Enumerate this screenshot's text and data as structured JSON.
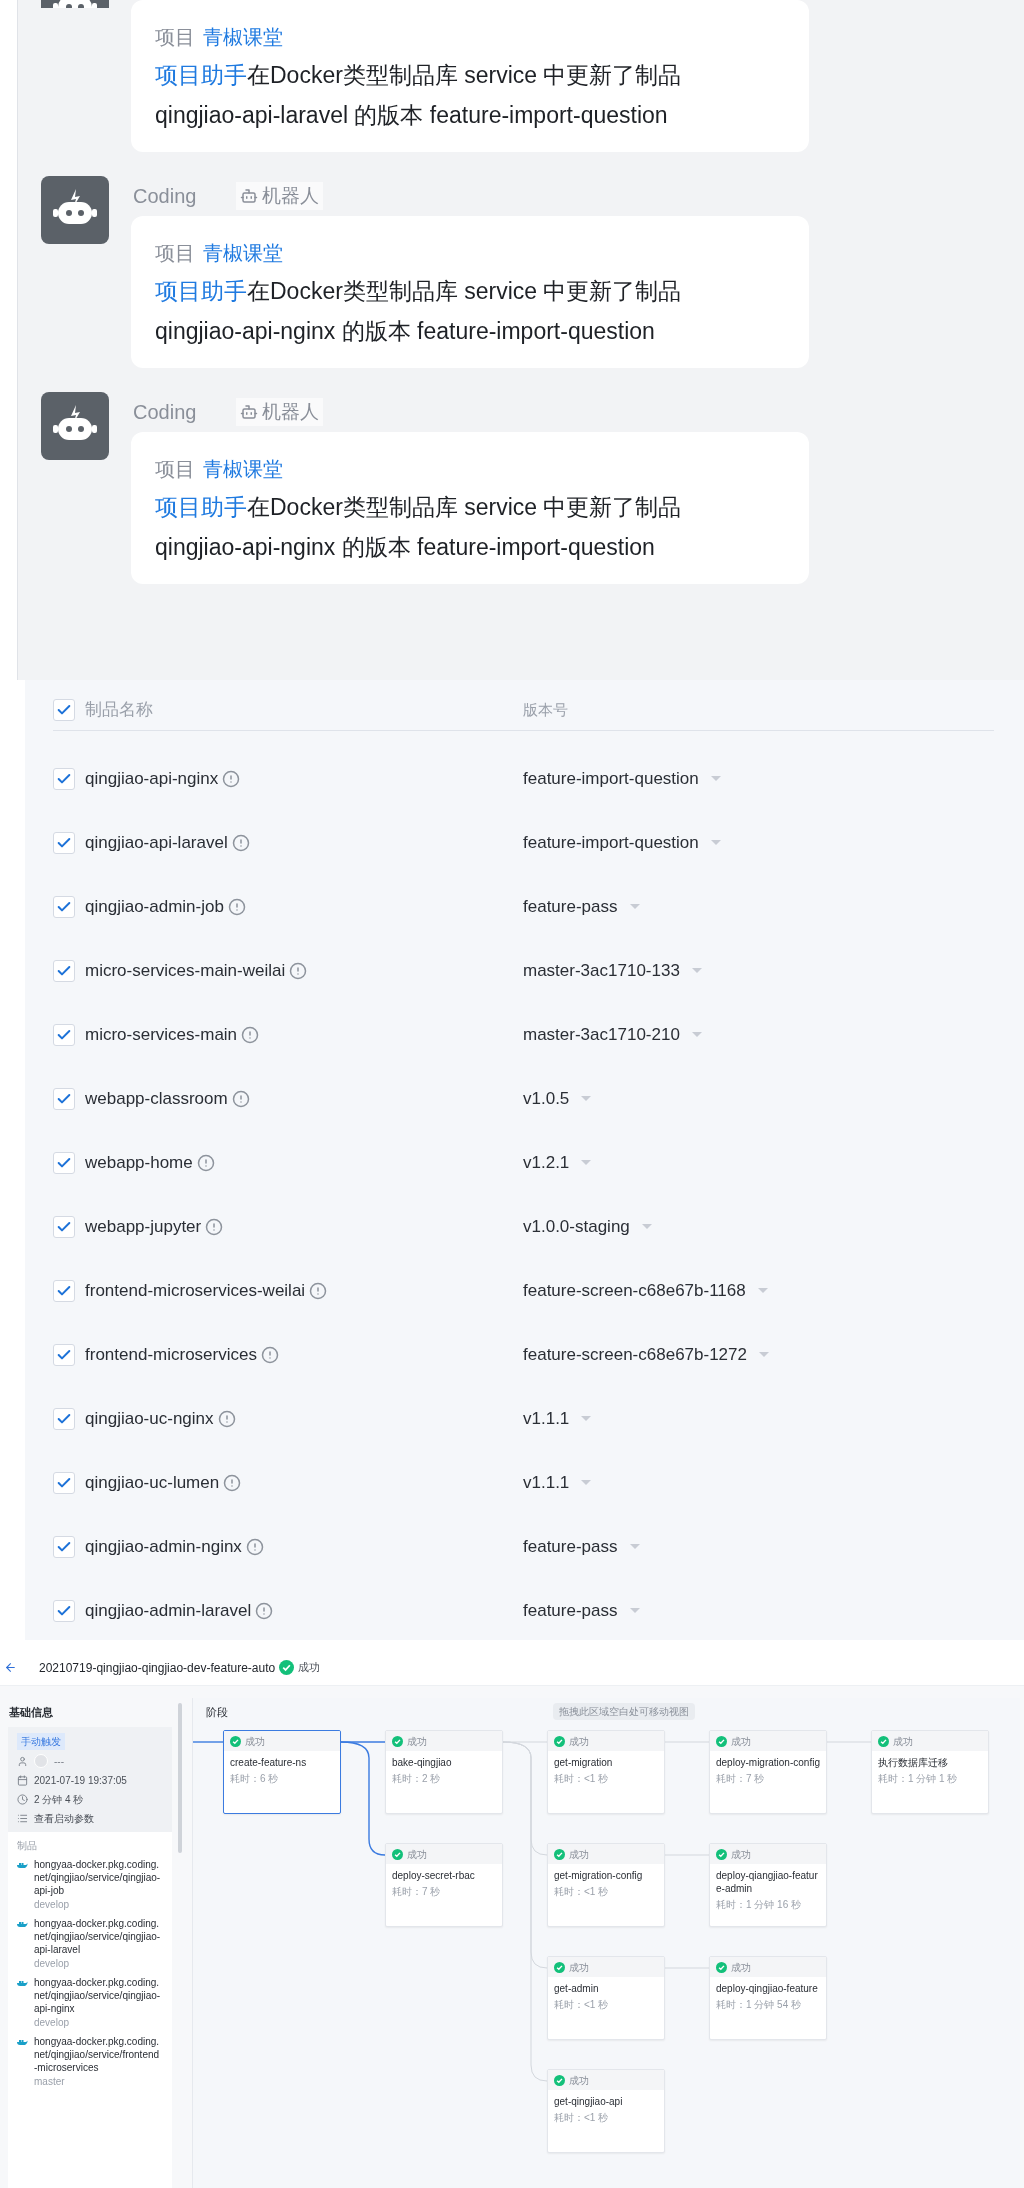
{
  "messages": [
    {
      "project_label": "项目",
      "project": "青椒课堂",
      "actor": "项目助手",
      "text": "在Docker类型制品库 service 中更新了制品",
      "artifact_line": "qingjiao-api-laravel 的版本 feature-import-question"
    },
    {
      "sender": "Coding",
      "tag": "机器人",
      "project_label": "项目",
      "project": "青椒课堂",
      "actor": "项目助手",
      "text": "在Docker类型制品库 service 中更新了制品",
      "artifact_line": "qingjiao-api-nginx 的版本 feature-import-question"
    },
    {
      "sender": "Coding",
      "tag": "机器人",
      "project_label": "项目",
      "project": "青椒课堂",
      "actor": "项目助手",
      "text": "在Docker类型制品库 service 中更新了制品",
      "artifact_line": "qingjiao-api-nginx 的版本 feature-import-question"
    }
  ],
  "table": {
    "name_header": "制品名称",
    "version_header": "版本号",
    "all_checked": true,
    "rows": [
      {
        "name": "qingjiao-api-nginx",
        "version": "feature-import-question",
        "checked": true
      },
      {
        "name": "qingjiao-api-laravel",
        "version": "feature-import-question",
        "checked": true
      },
      {
        "name": "qingjiao-admin-job",
        "version": "feature-pass",
        "checked": true
      },
      {
        "name": "micro-services-main-weilai",
        "version": "master-3ac1710-133",
        "checked": true
      },
      {
        "name": "micro-services-main",
        "version": "master-3ac1710-210",
        "checked": true
      },
      {
        "name": "webapp-classroom",
        "version": "v1.0.5",
        "checked": true
      },
      {
        "name": "webapp-home",
        "version": "v1.2.1",
        "checked": true
      },
      {
        "name": "webapp-jupyter",
        "version": "v1.0.0-staging",
        "checked": true
      },
      {
        "name": "frontend-microservices-weilai",
        "version": "feature-screen-c68e67b-1168",
        "checked": true
      },
      {
        "name": "frontend-microservices",
        "version": "feature-screen-c68e67b-1272",
        "checked": true
      },
      {
        "name": "qingjiao-uc-nginx",
        "version": "v1.1.1",
        "checked": true
      },
      {
        "name": "qingjiao-uc-lumen",
        "version": "v1.1.1",
        "checked": true
      },
      {
        "name": "qingjiao-admin-nginx",
        "version": "feature-pass",
        "checked": true
      },
      {
        "name": "qingjiao-admin-laravel",
        "version": "feature-pass",
        "checked": true
      }
    ]
  },
  "pipeline": {
    "title": "20210719-qingjiao-qingjiao-dev-feature-auto",
    "status": "成功",
    "sidebar": {
      "heading": "基础信息",
      "trigger": "手动触发",
      "user": "---",
      "time": "2021-07-19 19:37:05",
      "duration": "2 分钟 4 秒",
      "params_link": "查看启动参数",
      "artifacts_heading": "制品",
      "artifacts": [
        {
          "path": "hongyaa-docker.pkg.coding.net/qingjiao/service/qingjiao-api-job",
          "branch": "develop"
        },
        {
          "path": "hongyaa-docker.pkg.coding.net/qingjiao/service/qingjiao-api-laravel",
          "branch": "develop"
        },
        {
          "path": "hongyaa-docker.pkg.coding.net/qingjiao/service/qingjiao-api-nginx",
          "branch": "develop"
        },
        {
          "path": "hongyaa-docker.pkg.coding.net/qingjiao/service/frontend-microservices",
          "branch": "master"
        }
      ]
    },
    "canvas": {
      "heading": "阶段",
      "hint": "拖拽此区域空白处可移动视图"
    },
    "columns": [
      {
        "stages": [
          {
            "status": "成功",
            "name": "create-feature-ns",
            "duration": "耗时：6 秒",
            "selected": true
          }
        ]
      },
      {
        "stages": [
          {
            "status": "成功",
            "name": "bake-qingjiao",
            "duration": "耗时：2 秒",
            "selected": false
          },
          {
            "status": "成功",
            "name": "deploy-secret-rbac",
            "duration": "耗时：7 秒",
            "selected": false
          }
        ]
      },
      {
        "stages": [
          {
            "status": "成功",
            "name": "get-migration",
            "duration": "耗时：<1 秒",
            "selected": false
          },
          {
            "status": "成功",
            "name": "get-migration-config",
            "duration": "耗时：<1 秒",
            "selected": false
          },
          {
            "status": "成功",
            "name": "get-admin",
            "duration": "耗时：<1 秒",
            "selected": false
          },
          {
            "status": "成功",
            "name": "get-qingjiao-api",
            "duration": "耗时：<1 秒",
            "selected": false
          }
        ]
      },
      {
        "stages": [
          {
            "status": "成功",
            "name": "deploy-migration-config",
            "duration": "耗时：7 秒",
            "selected": false
          },
          {
            "status": "成功",
            "name": "deploy-qiangjiao-feature-admin",
            "duration": "耗时：1 分钟 16 秒",
            "selected": false
          },
          {
            "status": "成功",
            "name": "deploy-qingjiao-feature",
            "duration": "耗时：1 分钟 54 秒",
            "selected": false
          }
        ]
      },
      {
        "stages": [
          {
            "status": "成功",
            "name": "执行数据库迁移",
            "duration": "耗时：1 分钟 1 秒",
            "selected": false
          }
        ]
      }
    ]
  }
}
